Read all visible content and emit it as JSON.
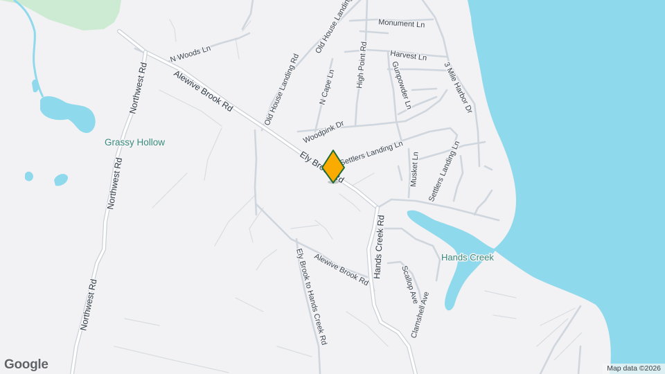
{
  "map": {
    "roads": {
      "alewive_brook_rd_upper": "Alewive Brook Rd",
      "alewive_brook_rd_lower": "Alewive Brook Rd",
      "ely_brook_rd": "Ely Brook Rd",
      "northwest_rd_top": "Northwest Rd",
      "northwest_rd_mid": "Northwest Rd",
      "northwest_rd_bottom": "Northwest Rd",
      "n_woods_ln": "N Woods Ln",
      "old_house_landing_rd": "Old House Landing Rd",
      "old_house_landing_rd_north": "Old House Landing Rd",
      "monument_ln": "Monument Ln",
      "harvest_ln": "Harvest Ln",
      "high_point_rd": "High Point Rd",
      "n_cape_ln": "N Cape Ln",
      "gunpowder_ln": "Gunpowder Ln",
      "three_mile_harbor_dr": "3 Mile Harbor Dr",
      "woodpink_dr": "Woodpink Dr",
      "settlers_landing_ln": "Settlers Landing Ln",
      "settlers_landing_ln_east": "Settlers Landing Ln",
      "musket_ln": "Musket Ln",
      "hands_creek_rd": "Hands Creek Rd",
      "ely_brook_to_hands_creek_rd": "Ely Brook to Hands Creek Rd",
      "scallop_ave": "Scallop Ave",
      "clamshell_ave": "Clamshell Ave"
    },
    "places": {
      "grassy_hollow": "Grassy Hollow",
      "hands_creek": "Hands Creek"
    },
    "marker": {
      "type": "location-pin",
      "color": "#f9ab00",
      "outline": "#1e6b3a"
    },
    "colors": {
      "land": "#f2f1f3",
      "water": "#8fd9ec",
      "park": "#c8ecd2",
      "road": "#ffffff",
      "road_casing": "#c9d0d8"
    }
  },
  "branding": {
    "logo": "Google",
    "attribution": "Map data ©2026"
  }
}
